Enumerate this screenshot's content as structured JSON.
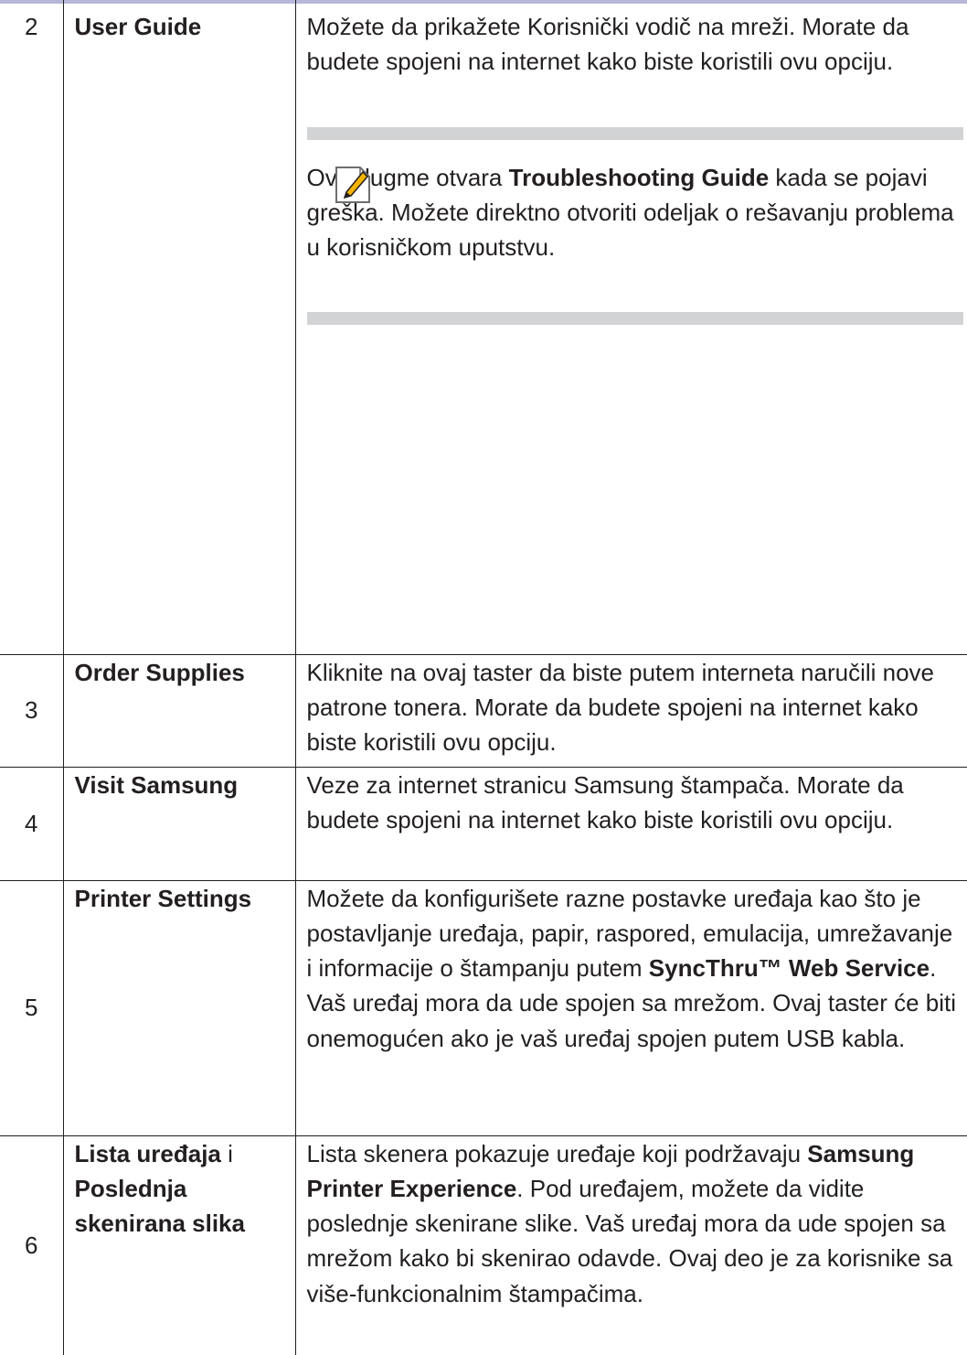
{
  "rows": [
    {
      "num": "2",
      "name": "User Guide",
      "desc": "Možete da prikažete Korisnički vodič na mreži. Morate da budete spojeni na internet kako biste koristili ovu opciju.",
      "note": {
        "icon": "note-pencil-icon",
        "pre": "Ovo dugme otvara ",
        "bold": "Troubleshooting Guide",
        "post": " kada se pojavi greška. Možete direktno otvoriti odeljak o rešavanju problema u korisničkom uputstvu."
      }
    },
    {
      "num": "3",
      "name": "Order Supplies",
      "desc": "Kliknite na ovaj taster da biste putem interneta naručili nove patrone tonera. Morate da budete spojeni na internet kako biste koristili ovu opciju."
    },
    {
      "num": "4",
      "name": "Visit Samsung",
      "desc": "Veze za internet stranicu Samsung štampača. Morate da budete spojeni na internet kako biste koristili ovu opciju."
    },
    {
      "num": "5",
      "name": "Printer Settings",
      "desc_pre": "Možete da konfigurišete razne postavke uređaja kao što je postavljanje uređaja, papir, raspored, emulacija, umrežavanje i informacije o štampanju putem ",
      "desc_bold": "SyncThru™ Web Service",
      "desc_post": ". Vaš uređaj mora da ude spojen sa mrežom. Ovaj taster će biti onemogućen ako je vaš uređaj spojen putem USB kabla."
    },
    {
      "num": "6",
      "name_a": "Lista uređaja",
      "name_join": " i ",
      "name_b": "Poslednja skenirana slika",
      "desc_pre": "Lista skenera pokazuje uređaje koji podržavaju ",
      "desc_bold": "Samsung Printer Experience",
      "desc_post": ". Pod uređajem, možete da vidite poslednje skenirane slike. Vaš uređaj mora da ude spojen sa mrežom kako bi skenirao odavde. Ovaj deo je za korisnike sa više-funkcionalnim štampačima."
    }
  ],
  "colors": {
    "text": "#231f20",
    "top_rule": "#b8b7d9",
    "note_band": "#d2d3d5",
    "note_icon_accent": "#f5b400"
  }
}
